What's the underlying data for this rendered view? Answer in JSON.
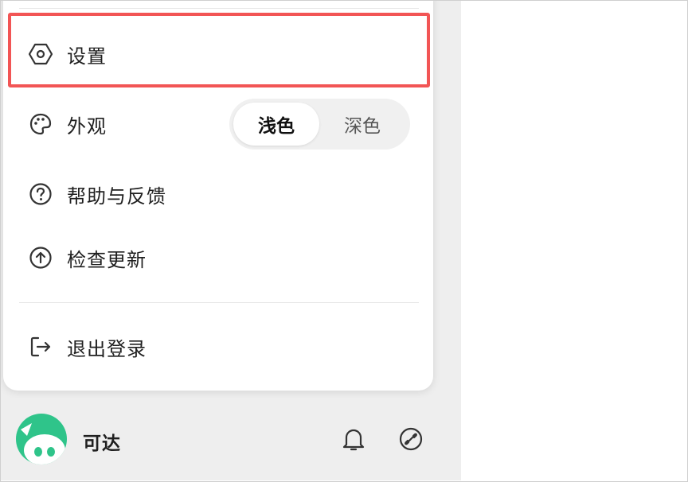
{
  "menu": {
    "settings": {
      "label": "设置",
      "icon": "hexagon-settings-icon"
    },
    "appearance": {
      "label": "外观",
      "icon": "palette-icon",
      "options": [
        "浅色",
        "深色"
      ],
      "selected": "浅色"
    },
    "help": {
      "label": "帮助与反馈",
      "icon": "help-circle-icon"
    },
    "update": {
      "label": "检查更新",
      "icon": "arrow-up-circle-icon"
    },
    "logout": {
      "label": "退出登录",
      "icon": "logout-icon"
    }
  },
  "user": {
    "name": "可达",
    "avatar_icon": "avatar-icon"
  },
  "bar_icons": [
    "bell-icon",
    "link-icon"
  ],
  "colors": {
    "highlight": "#f25555",
    "avatar_green": "#2fc48a"
  }
}
